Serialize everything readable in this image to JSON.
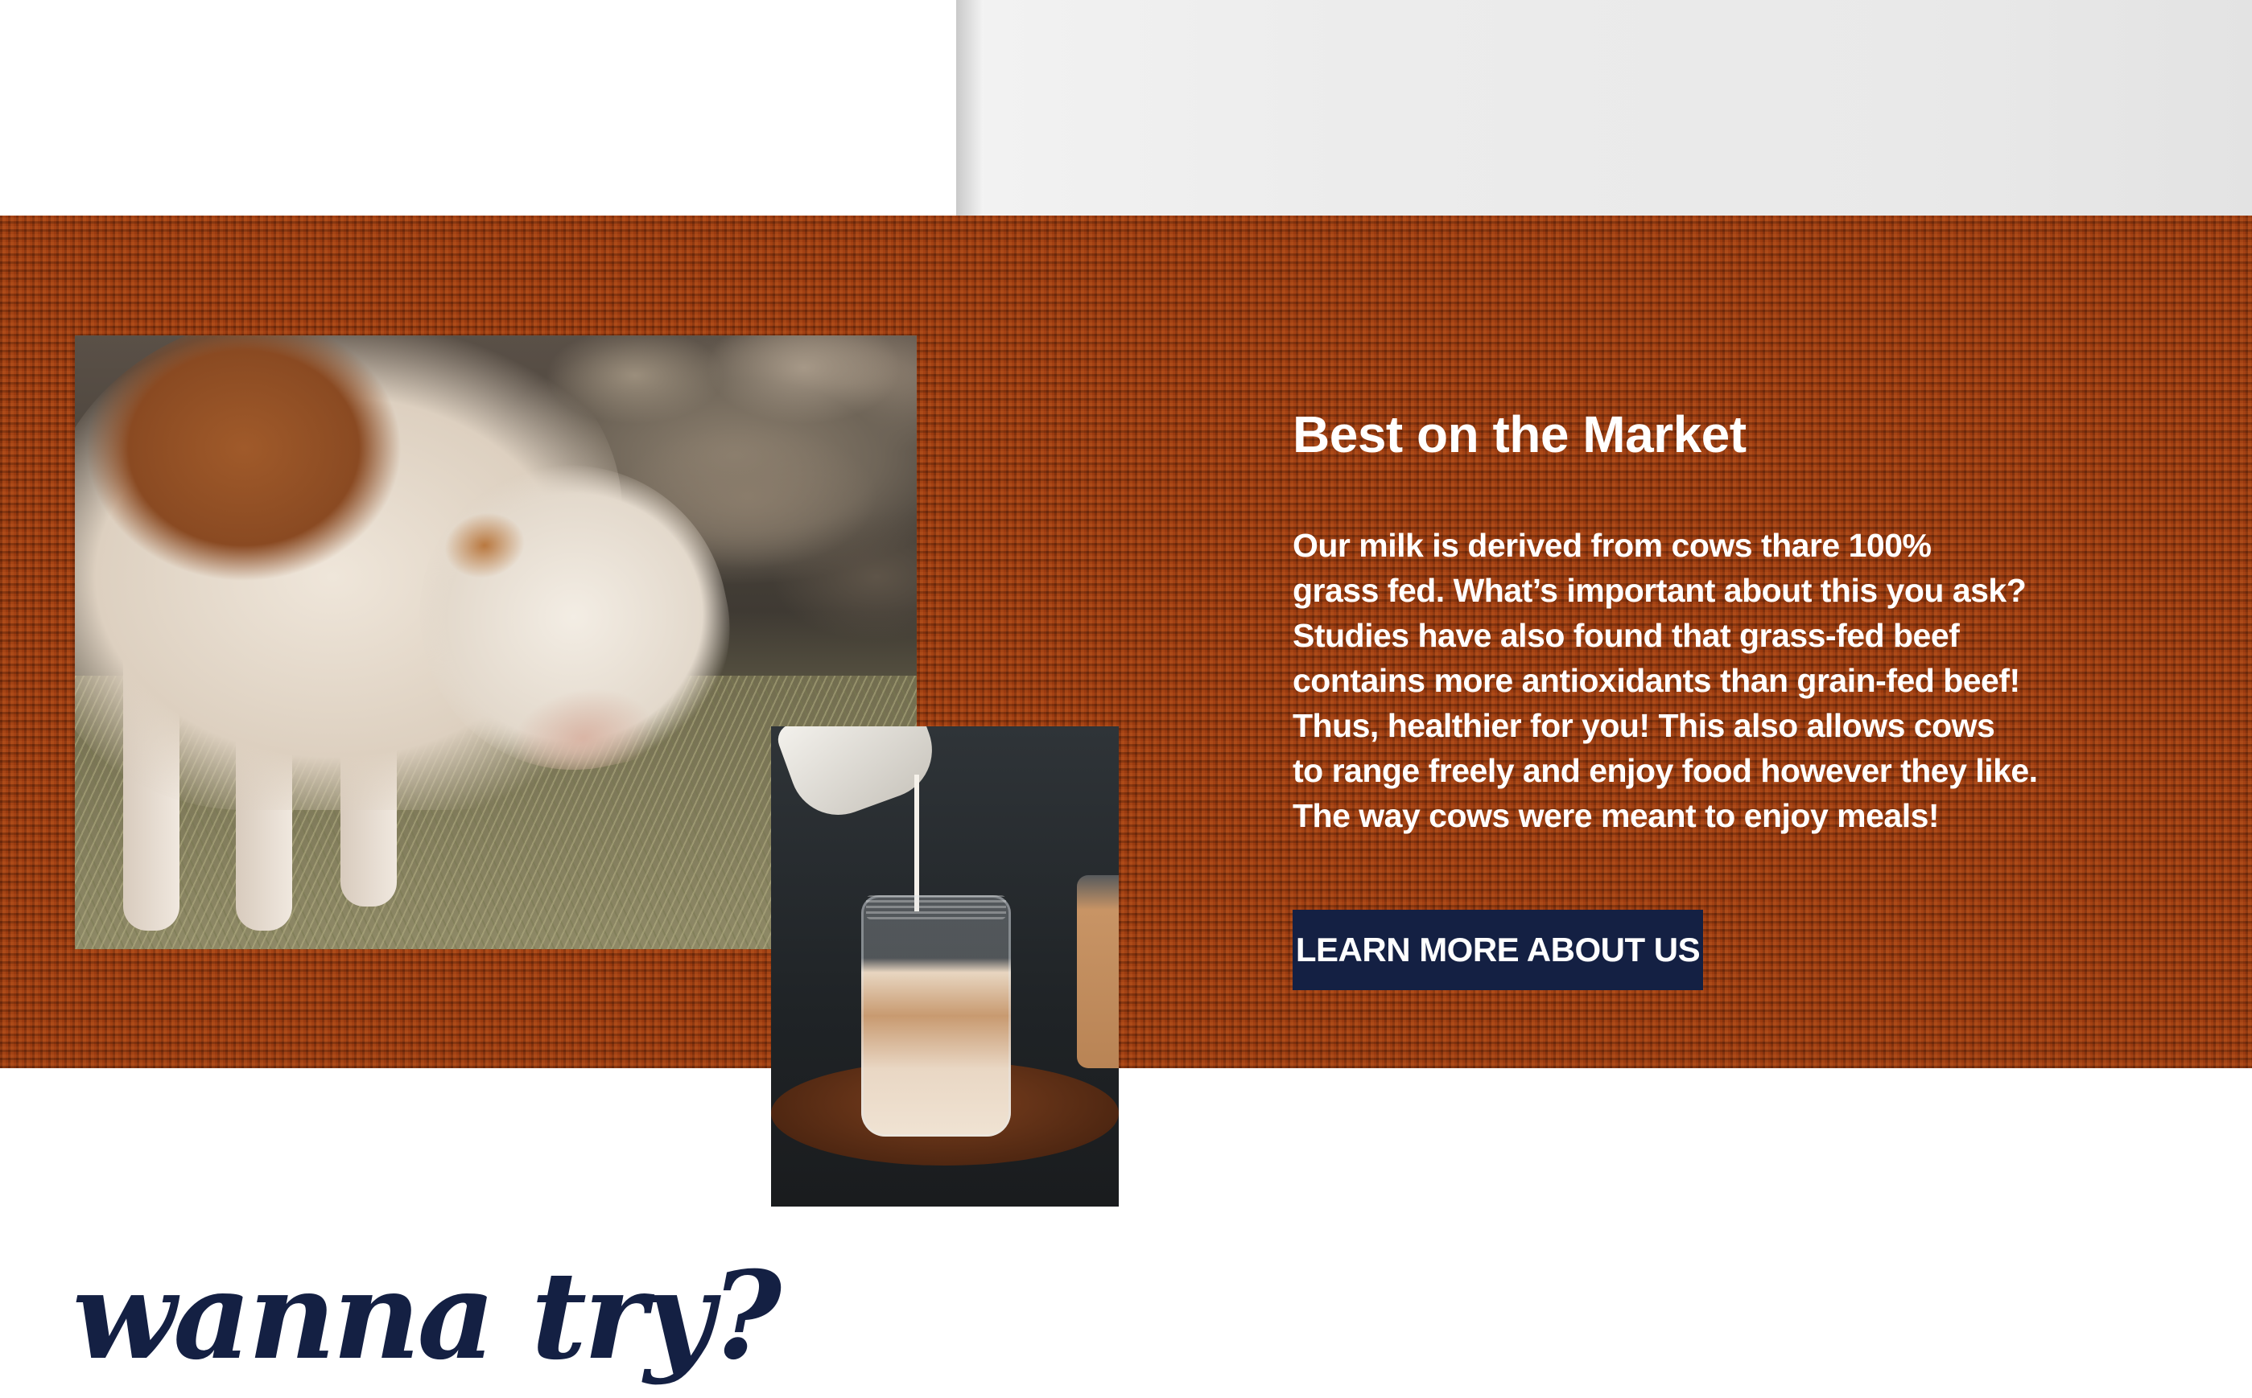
{
  "section": {
    "heading": "Best on the Market",
    "paragraph_lines": [
      "Our milk is derived from cows thare 100%",
      "grass fed. What’s important about this you ask?",
      "Studies have also found that grass-fed beef",
      "contains more antioxidants than grain-fed beef!",
      "Thus, healthier for you! This also allows cows",
      "to range freely and enjoy food however they like.",
      "The way cows were meant to enjoy meals!"
    ],
    "cta_label": "LEARN MORE ABOUT US"
  },
  "tagline": "wanna try?",
  "colors": {
    "band": "#9a3a0f",
    "button": "#142043",
    "tagline": "#142043",
    "text_on_band": "#ffffff"
  }
}
